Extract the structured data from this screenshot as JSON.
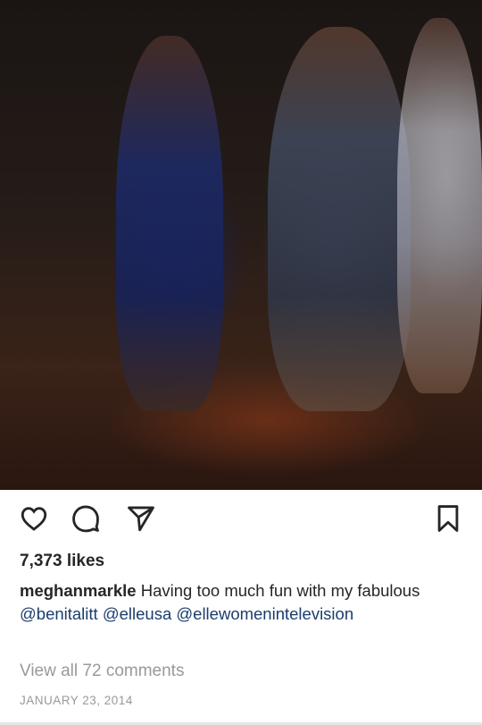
{
  "post": {
    "photo_icon": "party-photo",
    "likes": "7,373 likes",
    "caption": {
      "username": "meghanmarkle",
      "text_1": "Having too much fun with my fabulous",
      "mention_1": "@benitalitt",
      "mention_2": "@elleusa",
      "mention_3": "@ellewomenintelevision"
    },
    "view_comments": "View all 72 comments",
    "date": "JANUARY 23, 2014"
  },
  "icons": {
    "like": "heart-icon",
    "comment": "comment-icon",
    "share": "send-icon",
    "save": "bookmark-icon"
  },
  "colors": {
    "text": "#262626",
    "mention": "#1b3d6d",
    "muted": "#999999"
  }
}
